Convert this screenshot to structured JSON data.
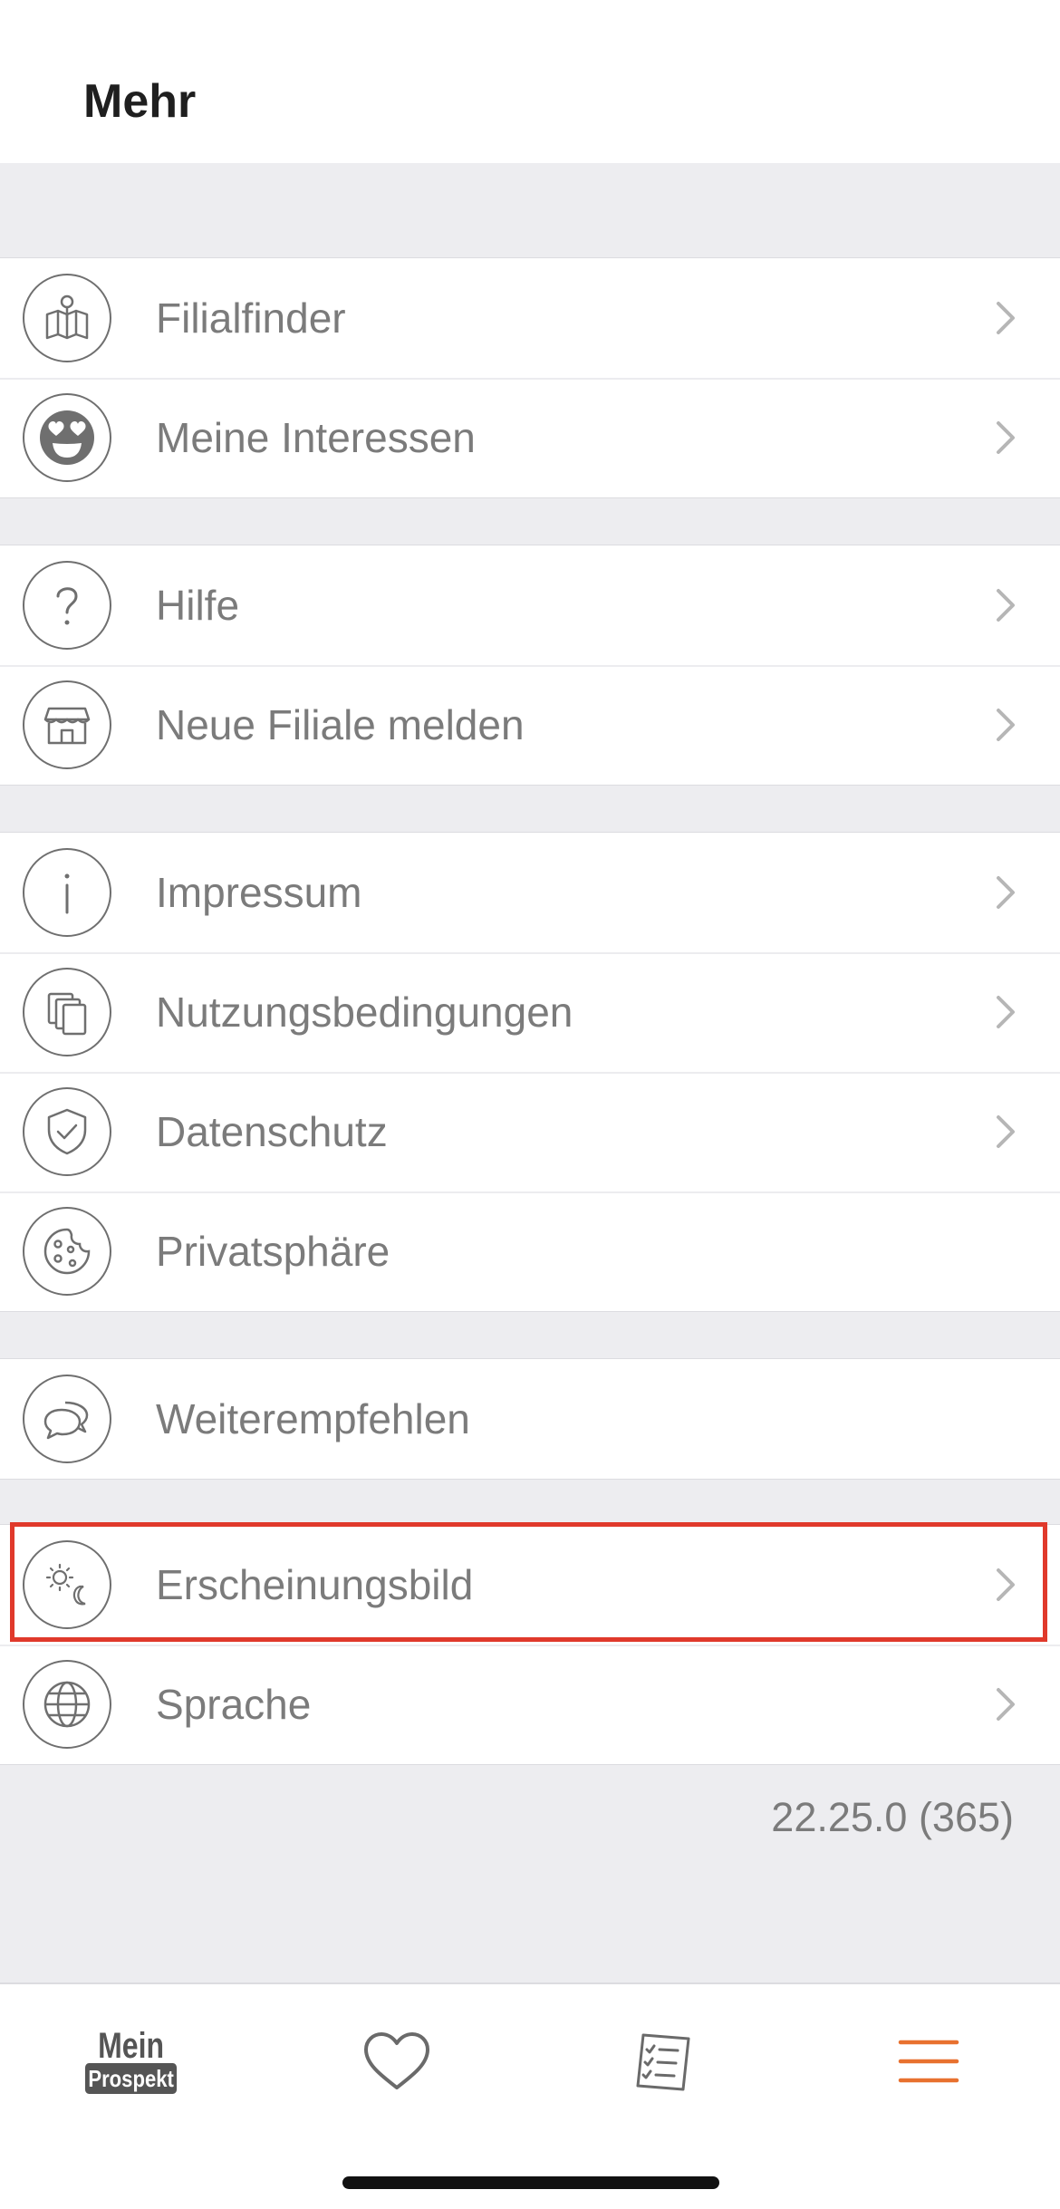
{
  "header": {
    "title": "Mehr"
  },
  "groups": [
    [
      {
        "label": "Filialfinder",
        "icon": "map-pin-icon",
        "chevron": true
      },
      {
        "label": "Meine Interessen",
        "icon": "heart-eyes-face-icon",
        "chevron": true
      }
    ],
    [
      {
        "label": "Hilfe",
        "icon": "question-mark-icon",
        "chevron": true
      },
      {
        "label": "Neue Filiale melden",
        "icon": "store-icon",
        "chevron": true
      }
    ],
    [
      {
        "label": "Impressum",
        "icon": "info-icon",
        "chevron": true
      },
      {
        "label": "Nutzungsbedingungen",
        "icon": "documents-icon",
        "chevron": true
      },
      {
        "label": "Datenschutz",
        "icon": "shield-check-icon",
        "chevron": true
      },
      {
        "label": "Privatsphäre",
        "icon": "cookie-icon",
        "chevron": false
      }
    ],
    [
      {
        "label": "Weiterempfehlen",
        "icon": "chat-bubbles-icon",
        "chevron": false
      }
    ],
    [
      {
        "label": "Erscheinungsbild",
        "icon": "sun-moon-icon",
        "chevron": true
      },
      {
        "label": "Sprache",
        "icon": "globe-icon",
        "chevron": true
      }
    ]
  ],
  "version": "22.25.0 (365)",
  "tabbar": {
    "logo_line1": "Mein",
    "logo_line2": "Prospekt",
    "tabs": [
      {
        "name": "mein-prospekt",
        "icon": "mein-prospekt-logo"
      },
      {
        "name": "favorites",
        "icon": "heart-icon"
      },
      {
        "name": "shopping-list",
        "icon": "checklist-icon"
      },
      {
        "name": "more",
        "icon": "hamburger-menu-icon",
        "active": true
      }
    ]
  },
  "colors": {
    "accent": "#e8712f",
    "icon_gray": "#6f6f6f",
    "text_gray": "#7b7b7b",
    "highlight": "#e0392b"
  }
}
